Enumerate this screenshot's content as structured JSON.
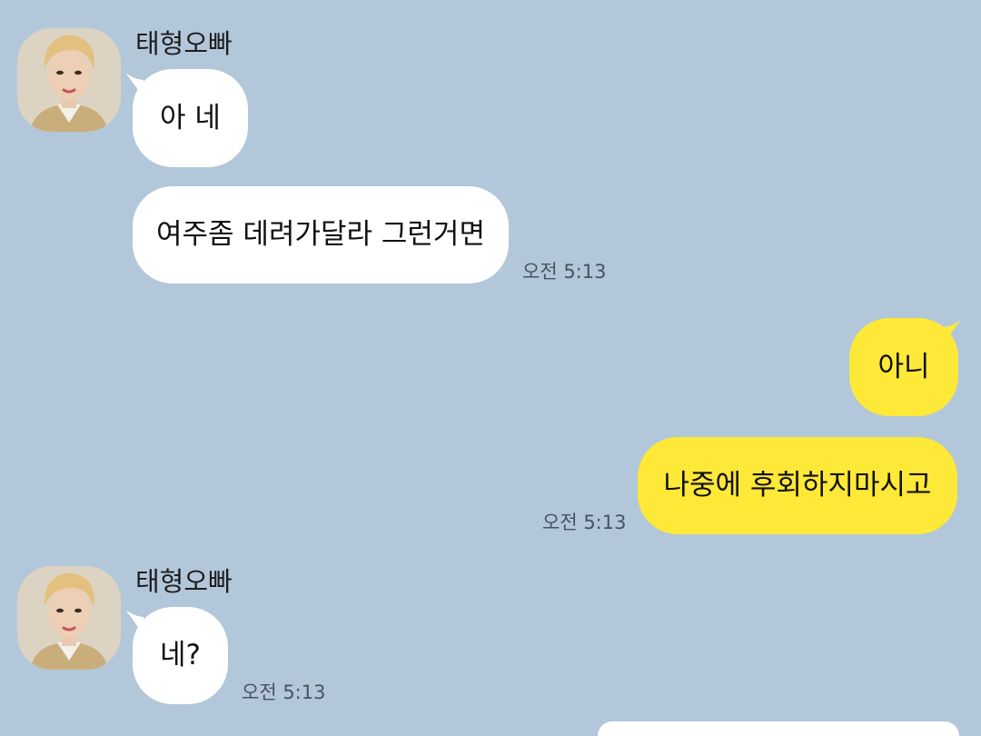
{
  "chat": {
    "colors": {
      "background": "#b2c7da",
      "incoming_bubble": "#ffffff",
      "outgoing_bubble": "#fee838"
    },
    "messages": [
      {
        "sender": "태형오빠",
        "text": "아 네",
        "direction": "incoming"
      },
      {
        "text": "여주좀 데려가달라 그런거면",
        "time": "오전 5:13",
        "direction": "incoming"
      },
      {
        "text": "아니",
        "direction": "outgoing"
      },
      {
        "text": "나중에 후회하지마시고",
        "time": "오전 5:13",
        "direction": "outgoing"
      },
      {
        "sender": "태형오빠",
        "text": "네?",
        "time": "오전 5:13",
        "direction": "incoming"
      }
    ]
  }
}
